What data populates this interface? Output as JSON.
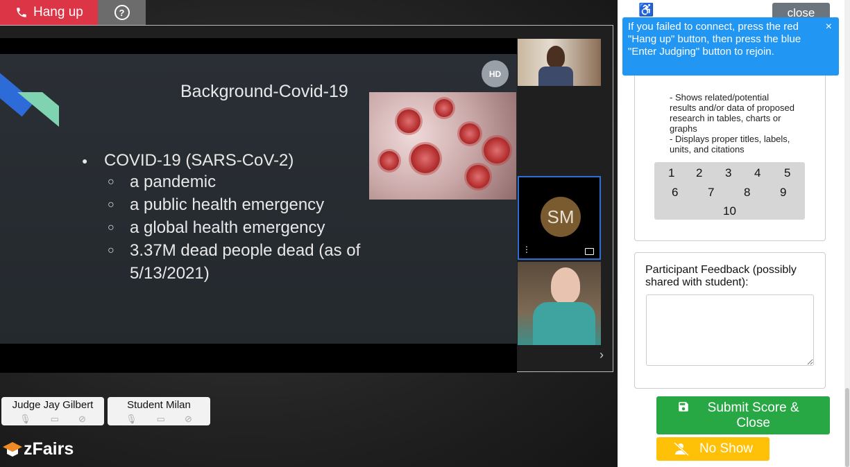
{
  "toolbar": {
    "hangup_label": "Hang up",
    "help_icon": "?"
  },
  "slide": {
    "title": "Background-Covid-19",
    "bullet": "COVID-19 (SARS-CoV-2)",
    "sub_items": [
      "a pandemic",
      "a public health emergency",
      "a global health emergency",
      "3.37M dead people dead (as of 5/13/2021)"
    ],
    "hd_badge": "HD"
  },
  "participants_tiles": {
    "avatar_initials": "SM",
    "menu_dots": "⋮"
  },
  "participants": [
    {
      "name": "Judge Jay Gilbert"
    },
    {
      "name": "Student Milan"
    }
  ],
  "logo": {
    "text": "zFairs"
  },
  "toast": {
    "message": "If you failed to connect, press the red \"Hang up\" button, then press the blue \"Enter Judging\" button to rejoin.",
    "close": "×"
  },
  "panel": {
    "close_label": "close",
    "criteria": "- Shows related/potential results and/or data of proposed research in tables, charts or graphs\n- Displays proper titles, labels, units, and citations",
    "scores": [
      "1",
      "2",
      "3",
      "4",
      "5",
      "6",
      "7",
      "8",
      "9",
      "10"
    ],
    "feedback_label": "Participant Feedback (possibly shared with student):",
    "feedback_value": "",
    "submit_label": "Submit Score & Close",
    "noshow_label": "No Show"
  },
  "colors": {
    "hangup": "#dc3545",
    "submit": "#28a745",
    "noshow": "#ffc107",
    "toast": "#2196f3"
  }
}
